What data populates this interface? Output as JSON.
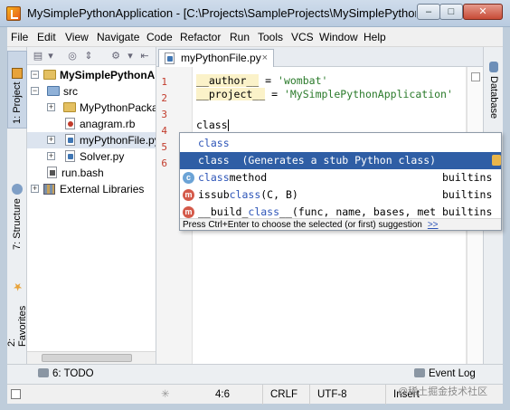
{
  "window": {
    "title": "MySimplePythonApplication - [C:\\Projects\\SampleProjects\\MySimplePythonA...",
    "minimize": "–",
    "maximize": "□",
    "close": "✕"
  },
  "menu": [
    "File",
    "Edit",
    "View",
    "Navigate",
    "Code",
    "Refactor",
    "Run",
    "Tools",
    "VCS",
    "Window",
    "Help"
  ],
  "left_tabs": {
    "project": "1: Project",
    "structure": "7: Structure",
    "favorites": "2: Favorites"
  },
  "right_tabs": {
    "database": "Database"
  },
  "project_tree": [
    {
      "label": "MySimplePythonApplication",
      "icon": "folder-icon"
    },
    {
      "label": "src",
      "icon": "source-folder-icon"
    },
    {
      "label": "MyPythonPackage",
      "icon": "package-folder-icon"
    },
    {
      "label": "anagram.rb",
      "icon": "ruby-file-icon"
    },
    {
      "label": "myPythonFile.py",
      "icon": "python-file-icon"
    },
    {
      "label": "Solver.py",
      "icon": "python-file-icon"
    },
    {
      "label": "run.bash",
      "icon": "bash-file-icon"
    },
    {
      "label": "External Libraries",
      "icon": "libraries-icon"
    }
  ],
  "editor": {
    "tab_label": "myPythonFile.py",
    "line_numbers": [
      "1",
      "2",
      "3",
      "4",
      "5",
      "6"
    ],
    "lines": {
      "l1_name": "__author__",
      "l1_eq": " = ",
      "l1_str": "'wombat'",
      "l2_name": "__project__",
      "l2_eq": " = ",
      "l2_str": "'MySimplePythonApplication'",
      "l4_text": "class"
    }
  },
  "completion": {
    "items": [
      {
        "match": "class",
        "rest": "",
        "type": "",
        "icon": ""
      },
      {
        "match": "class",
        "rest": "  (Generates a stub Python class)",
        "type": "",
        "icon": ""
      },
      {
        "match": "class",
        "rest": "method",
        "type": "builtins",
        "icon": "c"
      },
      {
        "pre": "issub",
        "match": "class",
        "rest": "(C, B)",
        "type": "builtins",
        "icon": "m"
      },
      {
        "pre": "__build_",
        "match": "class",
        "rest": "__(func, name, bases, met",
        "type": "builtins",
        "icon": "m"
      }
    ],
    "hint": "Press Ctrl+Enter to choose the selected (or first) suggestion",
    "hint_link": ">>"
  },
  "bottom_bar": {
    "todo": "6: TODO",
    "event_log": "Event Log"
  },
  "status_bar": {
    "position": "4:6",
    "line_separator": "CRLF",
    "encoding": "UTF-8",
    "mode": "Insert",
    "watermark": "@稀土掘金技术社区"
  }
}
